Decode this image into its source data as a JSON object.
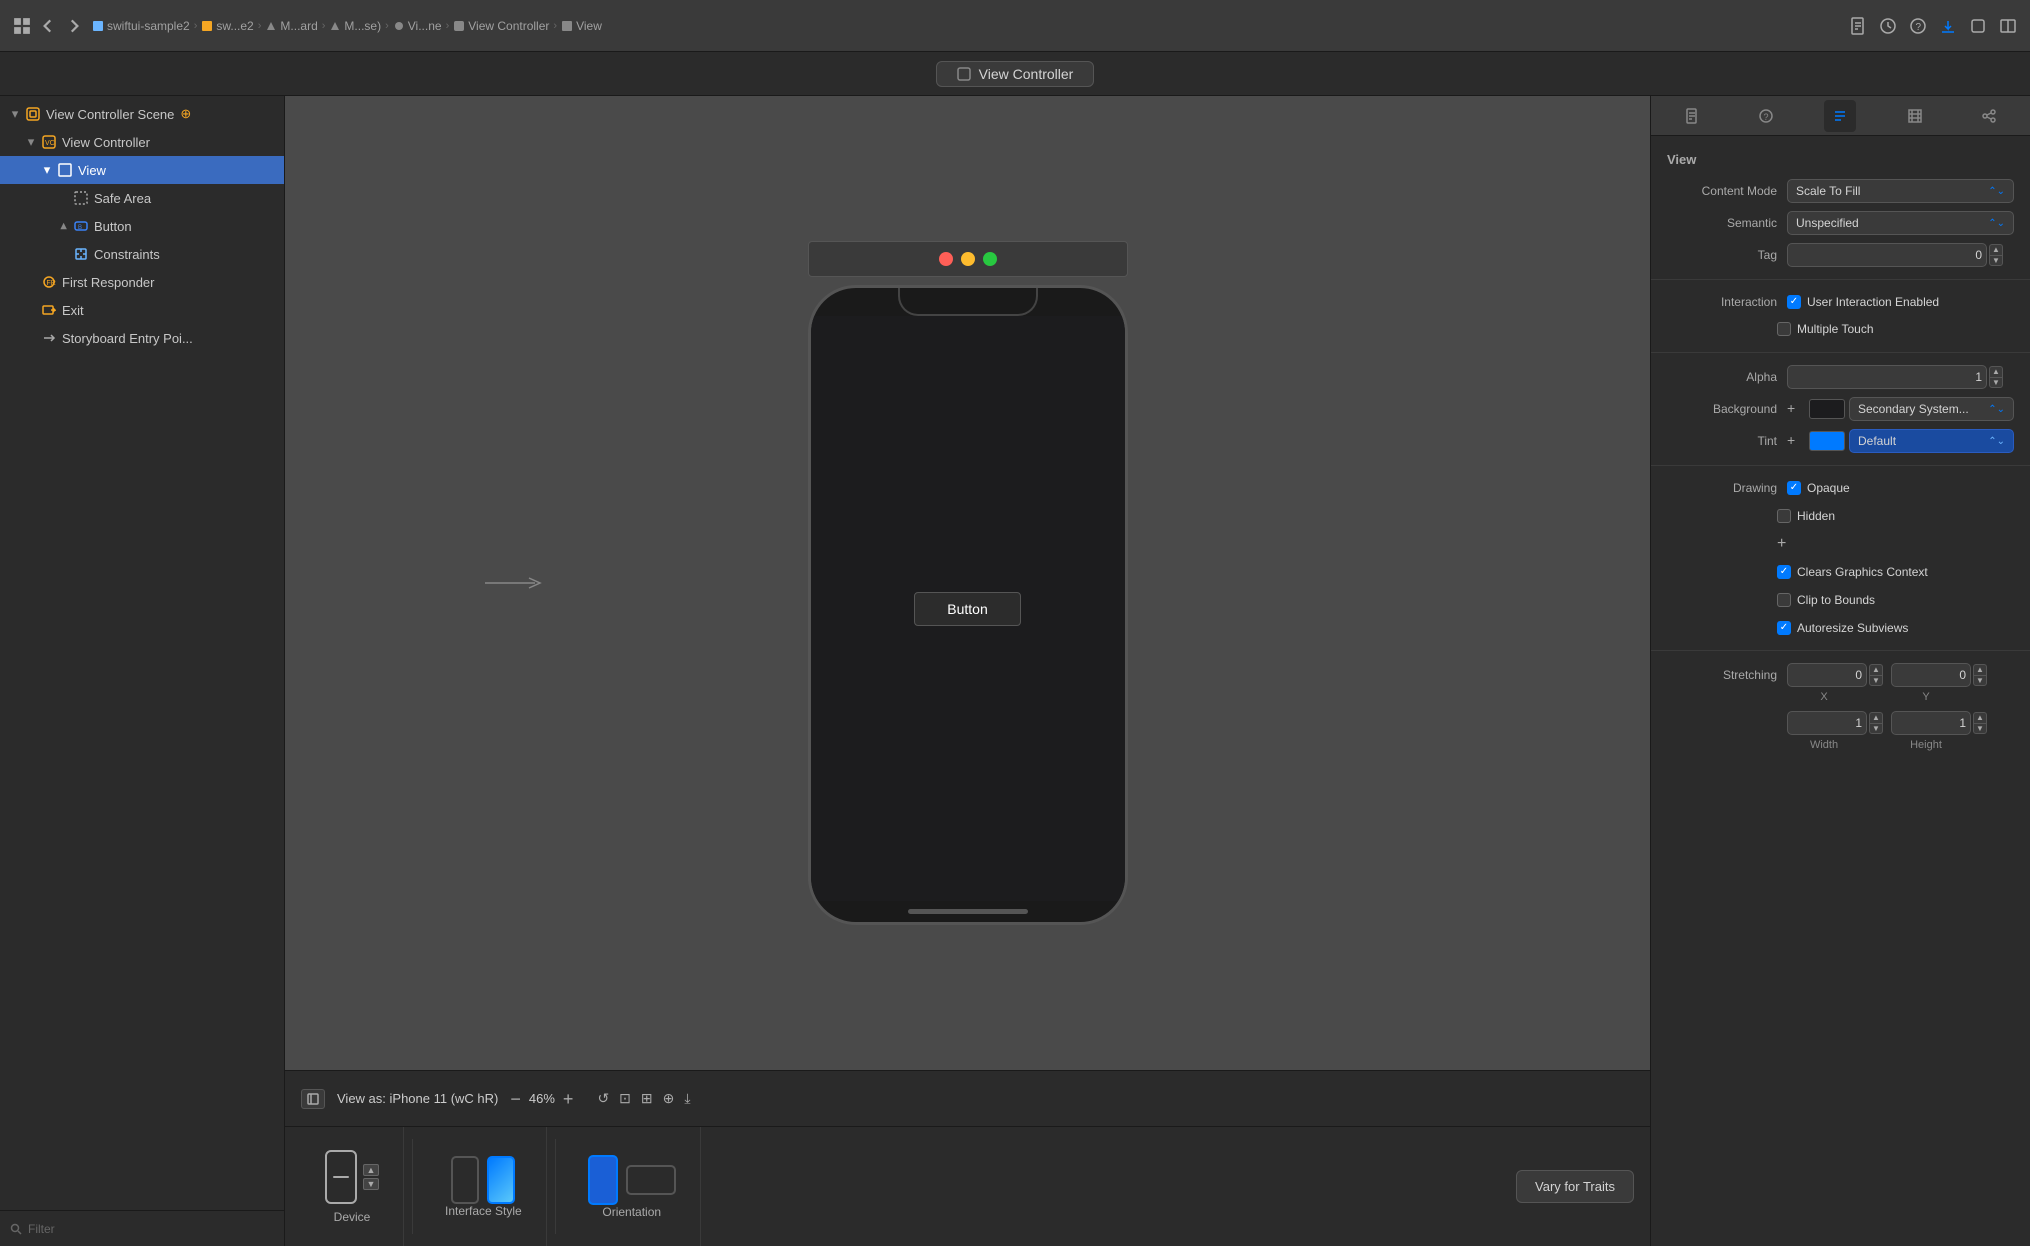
{
  "topbar": {
    "project": "swiftui-sample2",
    "breadcrumbs": [
      "swiftui-sample2",
      "sw...e2",
      "M...ard",
      "M...se)",
      "Vi...ne",
      "View Controller",
      "View"
    ],
    "nav_back": "‹",
    "nav_forward": "›"
  },
  "sidebar": {
    "title": "View Controller Scene",
    "items": [
      {
        "id": "scene",
        "label": "View Controller Scene",
        "indent": 1,
        "expanded": true,
        "icon": "scene-icon",
        "pinned": true
      },
      {
        "id": "vc",
        "label": "View Controller",
        "indent": 2,
        "expanded": true,
        "icon": "vc-icon"
      },
      {
        "id": "view",
        "label": "View",
        "indent": 3,
        "expanded": true,
        "icon": "view-icon",
        "selected": true
      },
      {
        "id": "safe-area",
        "label": "Safe Area",
        "indent": 4,
        "icon": "safe-area-icon"
      },
      {
        "id": "button",
        "label": "Button",
        "indent": 4,
        "expanded": false,
        "icon": "button-icon"
      },
      {
        "id": "constraints",
        "label": "Constraints",
        "indent": 4,
        "icon": "constraints-icon"
      },
      {
        "id": "first-responder",
        "label": "First Responder",
        "indent": 2,
        "icon": "responder-icon"
      },
      {
        "id": "exit",
        "label": "Exit",
        "indent": 2,
        "icon": "exit-icon"
      },
      {
        "id": "storyboard",
        "label": "Storyboard Entry Poi...",
        "indent": 2,
        "icon": "storyboard-icon"
      }
    ],
    "filter_placeholder": "Filter"
  },
  "canvas": {
    "device_label": "View as: iPhone 11 (wC hR)",
    "zoom": "46%",
    "button_label": "Button",
    "tab_title": "View Controller",
    "window_buttons": [
      "red",
      "yellow",
      "green"
    ]
  },
  "bottom_toolbar": {
    "device_label": "Device",
    "interface_label": "Interface Style",
    "orientation_label": "Orientation",
    "vary_traits_label": "Vary for Traits"
  },
  "inspector": {
    "section_title": "View",
    "content_mode_label": "Content Mode",
    "content_mode_value": "Scale To Fill",
    "semantic_label": "Semantic",
    "semantic_value": "Unspecified",
    "tag_label": "Tag",
    "tag_value": "0",
    "interaction_label": "Interaction",
    "user_interaction_label": "User Interaction Enabled",
    "multiple_touch_label": "Multiple Touch",
    "alpha_label": "Alpha",
    "alpha_value": "1",
    "background_label": "Background",
    "background_value": "Secondary System...",
    "tint_label": "Tint",
    "tint_value": "Default",
    "drawing_label": "Drawing",
    "opaque_label": "Opaque",
    "hidden_label": "Hidden",
    "clears_graphics_label": "Clears Graphics Context",
    "clip_to_bounds_label": "Clip to Bounds",
    "autoresize_label": "Autoresize Subviews",
    "stretching_label": "Stretching",
    "x_label": "X",
    "y_label": "Y",
    "width_label": "Width",
    "height_label": "Height",
    "stretch_x": "0",
    "stretch_y": "0",
    "stretch_w": "1",
    "stretch_h": "1"
  }
}
